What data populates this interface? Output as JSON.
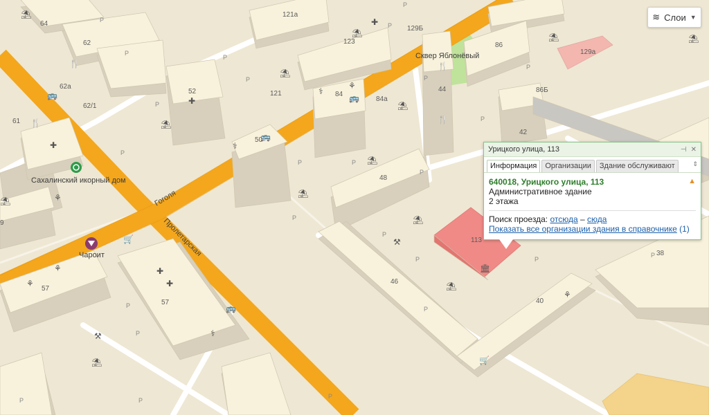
{
  "colors": {
    "ground": "#eee7d3",
    "road_major": "#f4a71c",
    "road_minor": "#ffffff",
    "building_top": "#f8f2dc",
    "building_side": "#d8d0bc",
    "building_selected": "#f08a86",
    "park": "#bfe39a",
    "popup_border": "#8cc28a",
    "address_green": "#2d7d2a",
    "link_blue": "#1a5faa"
  },
  "streets": {
    "gogolya": "Гоголя",
    "proletarskaya": "Пролетарская"
  },
  "houses": {
    "h64": "64",
    "h62": "62",
    "h62a": "62а",
    "h62_1": "62/1",
    "h61": "61",
    "h52": "52",
    "h121a": "121а",
    "h121": "121",
    "h123": "123",
    "h129b": "129Б",
    "h84": "84",
    "h84a": "84а",
    "h86": "86",
    "h86b": "86Б",
    "h129a": "129а",
    "h44": "44",
    "h42": "42",
    "h50": "50",
    "h48": "48",
    "h113": "113",
    "h46": "46",
    "h40": "40",
    "h38": "38",
    "h57a": "57",
    "h57b": "57",
    "h9": "9"
  },
  "pois": {
    "caviar_house": "Сахалинский икорный дом",
    "charoit": "Чароит",
    "park_name": "Сквер Яблонёвый"
  },
  "icons": [
    "landmark-icon",
    "restaurant-icon",
    "pharmacy-icon",
    "bus-stop-icon",
    "playground-icon",
    "parking-icon",
    "shop-icon",
    "fitness-icon",
    "hospital-icon"
  ],
  "layers": {
    "label": "Слои"
  },
  "popup": {
    "title": "Урицкого улица, 113",
    "tabs": [
      "Информация",
      "Организации",
      "Здание обслуживают"
    ],
    "address": "640018, Урицкого улица, 113",
    "type": "Административное здание",
    "floors": "2 этажа",
    "route_label": "Поиск проезда:",
    "route_from": "отсюда",
    "route_dash": "–",
    "route_to": "сюда",
    "show_all": "Показать все организации здания в справочнике",
    "count": "(1)"
  }
}
